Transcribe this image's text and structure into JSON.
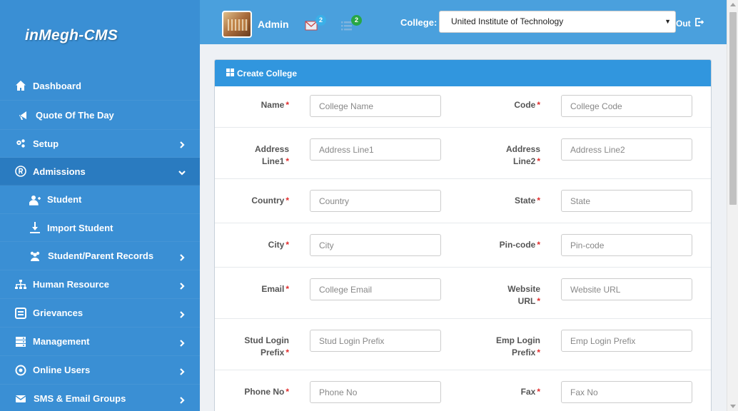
{
  "brand": "inMegh-CMS",
  "colors": {
    "sidebar": "#3a8fd4",
    "header": "#4aa0dd",
    "panel_head": "#3196de",
    "required": "#e02b2b"
  },
  "sidebar": {
    "items": [
      {
        "label": "Dashboard",
        "icon": "home-icon"
      },
      {
        "label": "Quote Of The Day",
        "icon": "megaphone-icon"
      },
      {
        "label": "Setup",
        "icon": "gears-icon"
      },
      {
        "label": "Admissions",
        "icon": "registered-icon"
      },
      {
        "label": "Student",
        "icon": "user-plus-icon"
      },
      {
        "label": "Import Student",
        "icon": "import-icon"
      },
      {
        "label": "Student/Parent Records",
        "icon": "users-icon"
      },
      {
        "label": "Human Resource",
        "icon": "sitemap-icon"
      },
      {
        "label": "Grievances",
        "icon": "inbox-icon"
      },
      {
        "label": "Management",
        "icon": "server-icon"
      },
      {
        "label": "Online Users",
        "icon": "dot-circle-icon"
      },
      {
        "label": "SMS & Email Groups",
        "icon": "envelope-icon"
      }
    ]
  },
  "header": {
    "user": "Admin",
    "mail_badge": "2",
    "tasks_badge": "2",
    "college_label": "College:",
    "college_value": "United Institute of Technology",
    "logout_label": "Out"
  },
  "panel": {
    "title": "Create College",
    "required_mark": "*",
    "fields": {
      "name": {
        "label": "Name",
        "placeholder": "College Name"
      },
      "code": {
        "label": "Code",
        "placeholder": "College Code"
      },
      "addr1": {
        "label1": "Address",
        "label2": "Line1",
        "placeholder": "Address Line1"
      },
      "addr2": {
        "label1": "Address",
        "label2": "Line2",
        "placeholder": "Address Line2"
      },
      "country": {
        "label": "Country",
        "placeholder": "Country"
      },
      "state": {
        "label": "State",
        "placeholder": "State"
      },
      "city": {
        "label": "City",
        "placeholder": "City"
      },
      "pincode": {
        "label": "Pin-code",
        "placeholder": "Pin-code"
      },
      "email": {
        "label": "Email",
        "placeholder": "College Email"
      },
      "website": {
        "label1": "Website",
        "label2": "URL",
        "placeholder": "Website URL"
      },
      "stud_login": {
        "label1": "Stud Login",
        "label2": "Prefix",
        "placeholder": "Stud Login Prefix"
      },
      "emp_login": {
        "label1": "Emp Login",
        "label2": "Prefix",
        "placeholder": "Emp Login Prefix"
      },
      "phone": {
        "label": "Phone No",
        "placeholder": "Phone No"
      },
      "fax": {
        "label": "Fax",
        "placeholder": "Fax No"
      }
    }
  }
}
